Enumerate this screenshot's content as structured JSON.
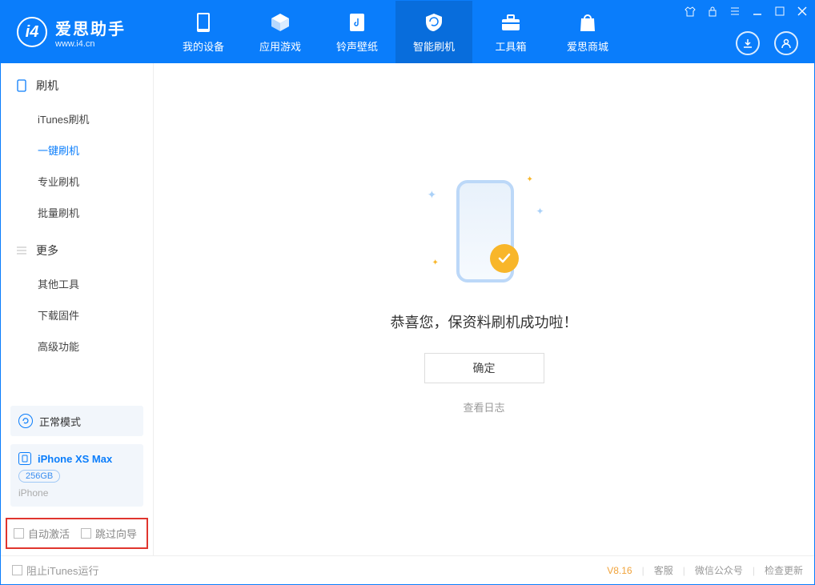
{
  "app": {
    "title": "爱思助手",
    "url": "www.i4.cn"
  },
  "tabs": {
    "device": "我的设备",
    "apps": "应用游戏",
    "ringtone": "铃声壁纸",
    "flash": "智能刷机",
    "toolbox": "工具箱",
    "store": "爱思商城"
  },
  "sidebar": {
    "section_flash": "刷机",
    "items_flash": {
      "itunes": "iTunes刷机",
      "onekey": "一键刷机",
      "pro": "专业刷机",
      "batch": "批量刷机"
    },
    "section_more": "更多",
    "items_more": {
      "other": "其他工具",
      "firmware": "下载固件",
      "advanced": "高级功能"
    },
    "status": "正常模式",
    "device": {
      "name": "iPhone XS Max",
      "storage": "256GB",
      "type": "iPhone"
    },
    "chk_activate": "自动激活",
    "chk_skip": "跳过向导"
  },
  "content": {
    "success": "恭喜您，保资料刷机成功啦！",
    "ok": "确定",
    "view_log": "查看日志"
  },
  "footer": {
    "block_itunes": "阻止iTunes运行",
    "version": "V8.16",
    "cs": "客服",
    "wechat": "微信公众号",
    "update": "检查更新"
  }
}
